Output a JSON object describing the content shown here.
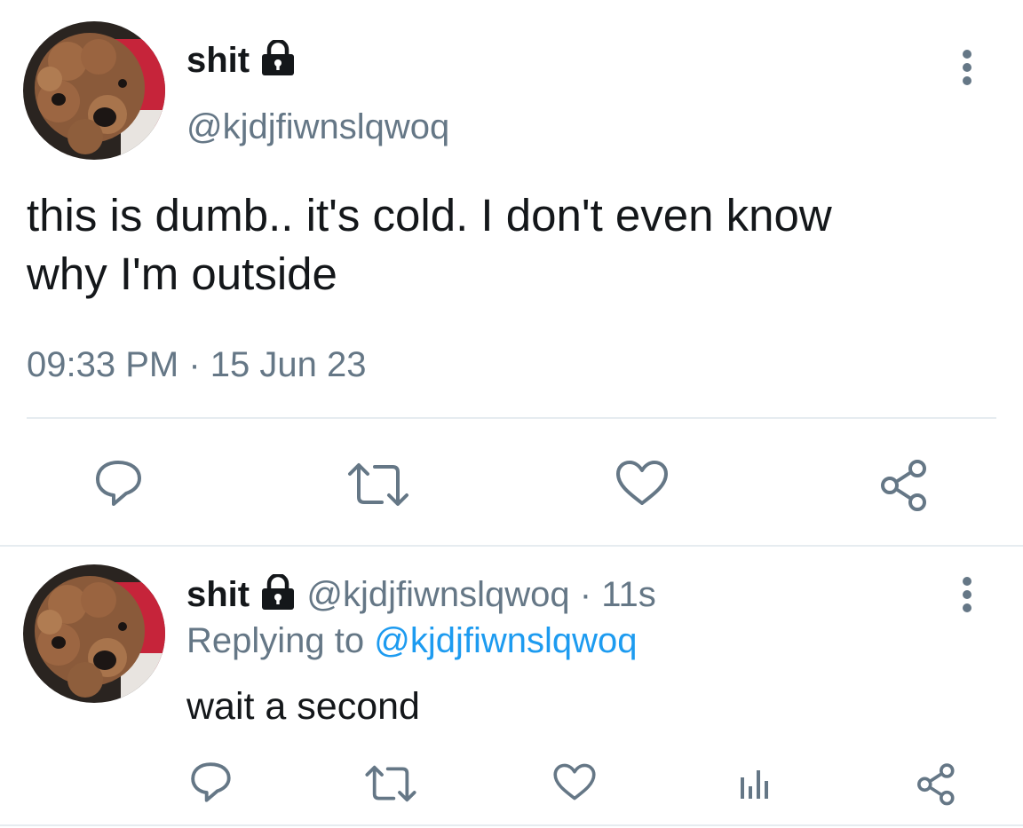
{
  "main_tweet": {
    "display_name": "shit",
    "handle": "@kjdjfiwnslqwoq",
    "text_line1": "this is dumb.. it's cold. I don't even know",
    "text_line2": "why I'm outside",
    "timestamp": "09:33 PM · 15 Jun 23",
    "actions": [
      "reply-icon",
      "retweet-icon",
      "like-icon",
      "share-icon"
    ]
  },
  "reply_tweet": {
    "display_name": "shit",
    "handle_time": "@kjdjfiwnslqwoq · 11s",
    "replying_prefix": "Replying to",
    "replying_handle": "@kjdjfiwnslqwoq",
    "text": "wait a second",
    "actions": [
      "reply-icon",
      "retweet-icon",
      "like-icon",
      "analytics-icon",
      "share-icon"
    ]
  },
  "colors": {
    "accent": "#1d9bf0",
    "muted": "#657786",
    "text": "#14171a",
    "divider": "#e6ecf0"
  }
}
